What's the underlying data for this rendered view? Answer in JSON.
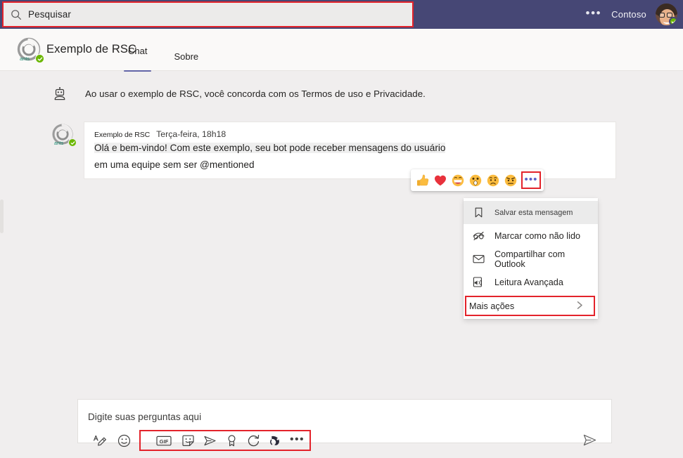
{
  "topbar": {
    "search": {
      "placeholder": "Pesquisar",
      "icon": "search-icon"
    },
    "more_label": "•••",
    "org_name": "Contoso",
    "presence": "available"
  },
  "app_header": {
    "title": "Exemplo de RSC",
    "tabs": [
      {
        "label": "Chat",
        "active": true
      },
      {
        "label": "Sobre",
        "active": false
      }
    ]
  },
  "chat": {
    "system_message": "Ao usar o exemplo de RSC, você concorda com os Termos de uso e Privacidade.",
    "message": {
      "author": "Exemplo de RSC",
      "timestamp": "Terça-feira, 18h18",
      "line1": "Olá e bem-vindo! Com este exemplo, seu bot pode receber mensagens do usuário",
      "line2": "em uma equipe sem ser @mentioned"
    }
  },
  "reactions": {
    "items": [
      {
        "name": "thumbs-up-reaction",
        "emoji": "👍"
      },
      {
        "name": "heart-reaction",
        "emoji": "❤️"
      },
      {
        "name": "laugh-reaction",
        "emoji": "😄"
      },
      {
        "name": "surprised-reaction",
        "emoji": "😮"
      },
      {
        "name": "sad-reaction",
        "emoji": "😢"
      },
      {
        "name": "angry-reaction",
        "emoji": "😠"
      }
    ],
    "more_label": "•••"
  },
  "context_menu": {
    "items": [
      {
        "label": "Salvar esta mensagem",
        "icon": "bookmark-icon",
        "hover": true
      },
      {
        "label": "Marcar como não lido",
        "icon": "eye-off-icon",
        "hover": false
      },
      {
        "label": "Compartilhar com Outlook",
        "icon": "envelope-icon",
        "hover": false
      },
      {
        "label": "Leitura Avançada",
        "icon": "immersive-reader-icon",
        "hover": false
      },
      {
        "label": "Mais ações",
        "icon": "chevron-right-icon",
        "hover": false,
        "highlighted": true
      }
    ]
  },
  "compose": {
    "placeholder": "Digite suas perguntas aqui",
    "tools": [
      {
        "name": "format-icon",
        "label": "Formatar"
      },
      {
        "name": "emoji-icon",
        "label": "Emoji"
      },
      {
        "name": "gif-icon",
        "label": "GIF"
      },
      {
        "name": "sticker-icon",
        "label": "Adesivo"
      },
      {
        "name": "stream-icon",
        "label": "Stream"
      },
      {
        "name": "praise-icon",
        "label": "Elogio"
      },
      {
        "name": "loop-icon",
        "label": "Loop"
      },
      {
        "name": "approvals-icon",
        "label": "Aprovações"
      },
      {
        "name": "more-options-icon",
        "label": "•••"
      }
    ],
    "send_label": "Enviar",
    "gif_label": "GIF"
  },
  "colors": {
    "topbar": "#464775",
    "accent": "#6264a7",
    "highlight_red": "#e3232b",
    "presence_green": "#6bb700",
    "chat_bg": "#f0eeee"
  }
}
